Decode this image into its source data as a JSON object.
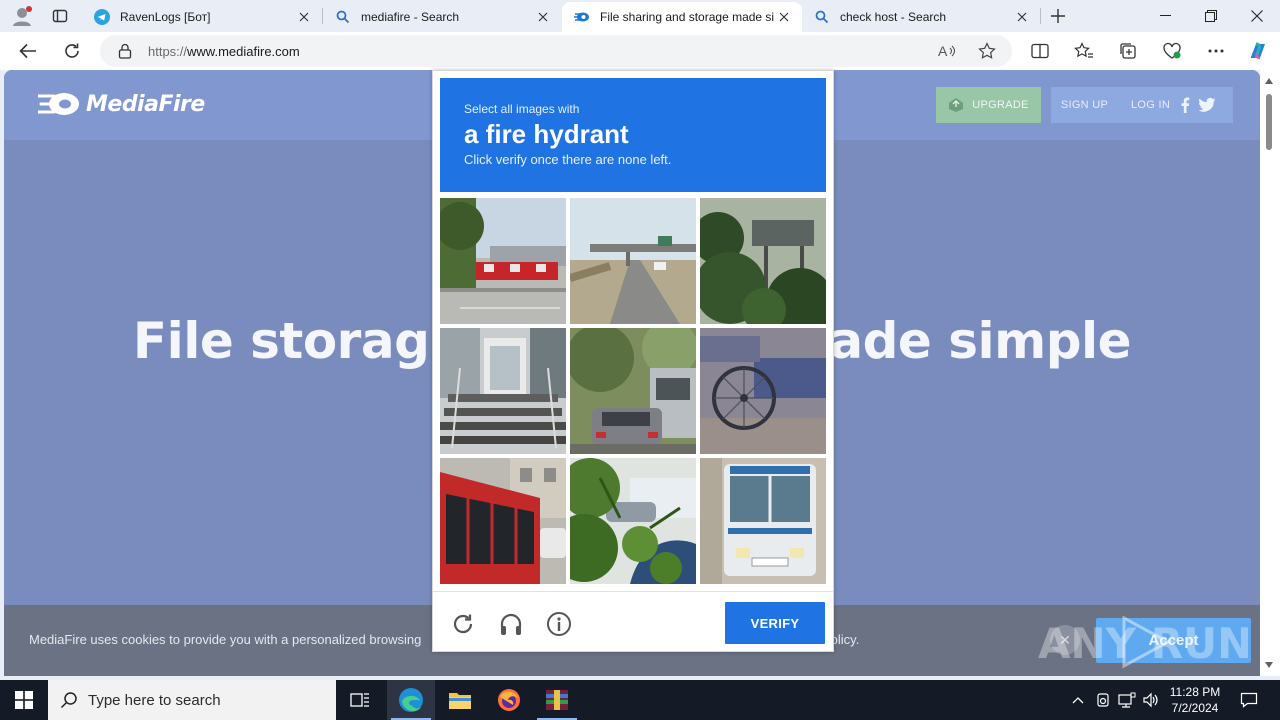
{
  "browser": {
    "tabs": [
      {
        "title": "RavenLogs [Бот]",
        "favicon": "telegram-icon"
      },
      {
        "title": "mediafire - Search",
        "favicon": "search-icon"
      },
      {
        "title": "File sharing and storage made sir",
        "favicon": "mediafire-icon",
        "active": true
      },
      {
        "title": "check host - Search",
        "favicon": "search-icon"
      }
    ],
    "url_scheme": "https://",
    "url_host": "www.mediafire.com"
  },
  "page": {
    "logo": "MediaFire",
    "header": {
      "upgrade": "UPGRADE",
      "signup": "SIGN UP",
      "login": "LOG IN"
    },
    "hero_left": "File storag",
    "hero_right": "ade simple",
    "cookie_text": "MediaFire uses cookies to provide you with a personalized browsing",
    "cookie_tail": "Policy.",
    "cookie_accept": "Accept"
  },
  "captcha": {
    "prompt_small": "Select all images with",
    "target": "a fire hydrant",
    "hint": "Click verify once there are none left.",
    "verify_label": "VERIFY",
    "tiles": [
      "red-trucks-depot",
      "highway-overpass",
      "highway-sign-trees",
      "building-stairs",
      "street-parked-cars",
      "bicycle-cart",
      "red-bus",
      "plants-car",
      "white-bus"
    ]
  },
  "watermark": "ANY RUN",
  "taskbar": {
    "search_placeholder": "Type here to search",
    "time": "11:28 PM",
    "date": "7/2/2024"
  },
  "colors": {
    "captcha_blue": "#1f73e3",
    "page_overlay": "#7a8bbd",
    "taskbar": "#141a26"
  }
}
